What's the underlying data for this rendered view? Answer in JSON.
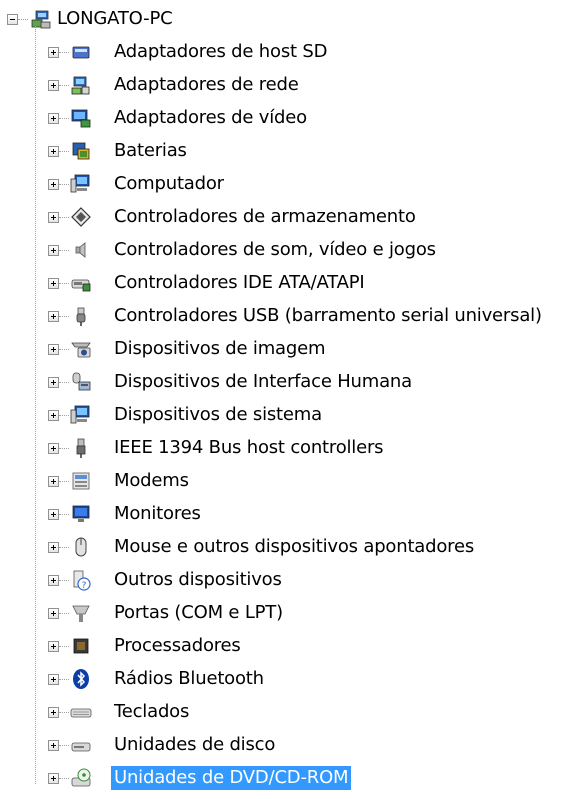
{
  "root": {
    "label": "LONGATO-PC",
    "icon": "computer-network-icon",
    "expanded": true
  },
  "selection_color": "#3399ff",
  "items": [
    {
      "label": "Adaptadores de host SD",
      "icon": "sd-card-icon"
    },
    {
      "label": "Adaptadores de rede",
      "icon": "network-adapter-icon"
    },
    {
      "label": "Adaptadores de vídeo",
      "icon": "display-adapter-icon"
    },
    {
      "label": "Baterias",
      "icon": "battery-icon"
    },
    {
      "label": "Computador",
      "icon": "computer-icon"
    },
    {
      "label": "Controladores de armazenamento",
      "icon": "storage-controller-icon"
    },
    {
      "label": "Controladores de som, vídeo e jogos",
      "icon": "speaker-icon"
    },
    {
      "label": "Controladores IDE ATA/ATAPI",
      "icon": "ide-controller-icon"
    },
    {
      "label": "Controladores USB (barramento serial universal)",
      "icon": "usb-icon"
    },
    {
      "label": "Dispositivos de imagem",
      "icon": "camera-icon"
    },
    {
      "label": "Dispositivos de Interface Humana",
      "icon": "hid-icon"
    },
    {
      "label": "Dispositivos de sistema",
      "icon": "system-device-icon"
    },
    {
      "label": "IEEE 1394 Bus host controllers",
      "icon": "firewire-icon"
    },
    {
      "label": "Modems",
      "icon": "modem-icon"
    },
    {
      "label": "Monitores",
      "icon": "monitor-icon"
    },
    {
      "label": "Mouse e outros dispositivos apontadores",
      "icon": "mouse-icon"
    },
    {
      "label": "Outros dispositivos",
      "icon": "unknown-device-icon"
    },
    {
      "label": "Portas (COM e LPT)",
      "icon": "port-icon"
    },
    {
      "label": "Processadores",
      "icon": "processor-icon"
    },
    {
      "label": "Rádios Bluetooth",
      "icon": "bluetooth-icon"
    },
    {
      "label": "Teclados",
      "icon": "keyboard-icon"
    },
    {
      "label": "Unidades de disco",
      "icon": "disk-drive-icon"
    },
    {
      "label": "Unidades de DVD/CD-ROM",
      "icon": "dvd-drive-icon",
      "selected": true
    }
  ]
}
